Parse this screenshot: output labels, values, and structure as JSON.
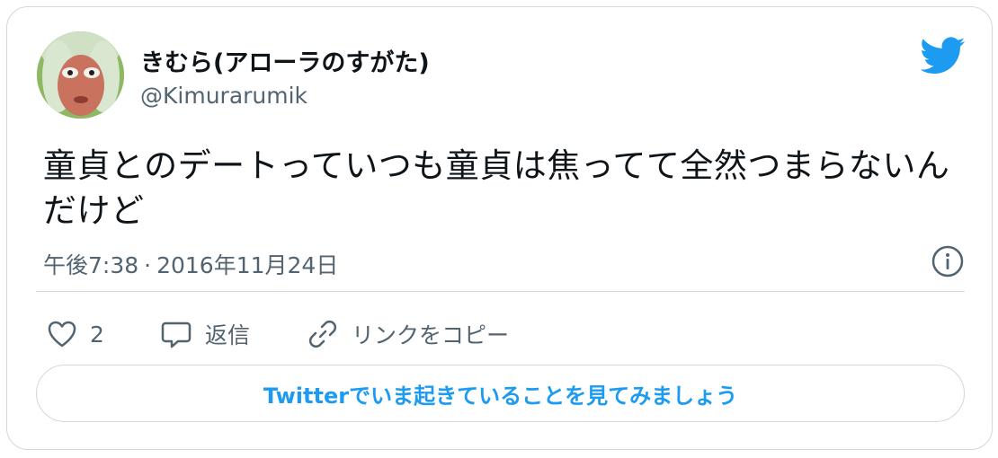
{
  "tweet": {
    "display_name": "きむら(アローラのすがた)",
    "handle": "@Kimurarumik",
    "text": "童貞とのデートっていつも童貞は焦ってて全然つまらないんだけど",
    "time": "午後7:38",
    "separator": "·",
    "date": "2016年11月24日"
  },
  "actions": {
    "like_count": "2",
    "reply_label": "返信",
    "copy_link_label": "リンクをコピー"
  },
  "cta": {
    "label": "Twitterでいま起きていることを見てみましょう"
  },
  "colors": {
    "brand": "#1d9bf0",
    "text_primary": "#0f1419",
    "text_secondary": "#536471",
    "border": "#cfd9de"
  },
  "icons": {
    "brand": "twitter-bird-icon",
    "info": "info-icon",
    "like": "heart-icon",
    "reply": "speech-bubble-icon",
    "copy": "link-icon"
  }
}
